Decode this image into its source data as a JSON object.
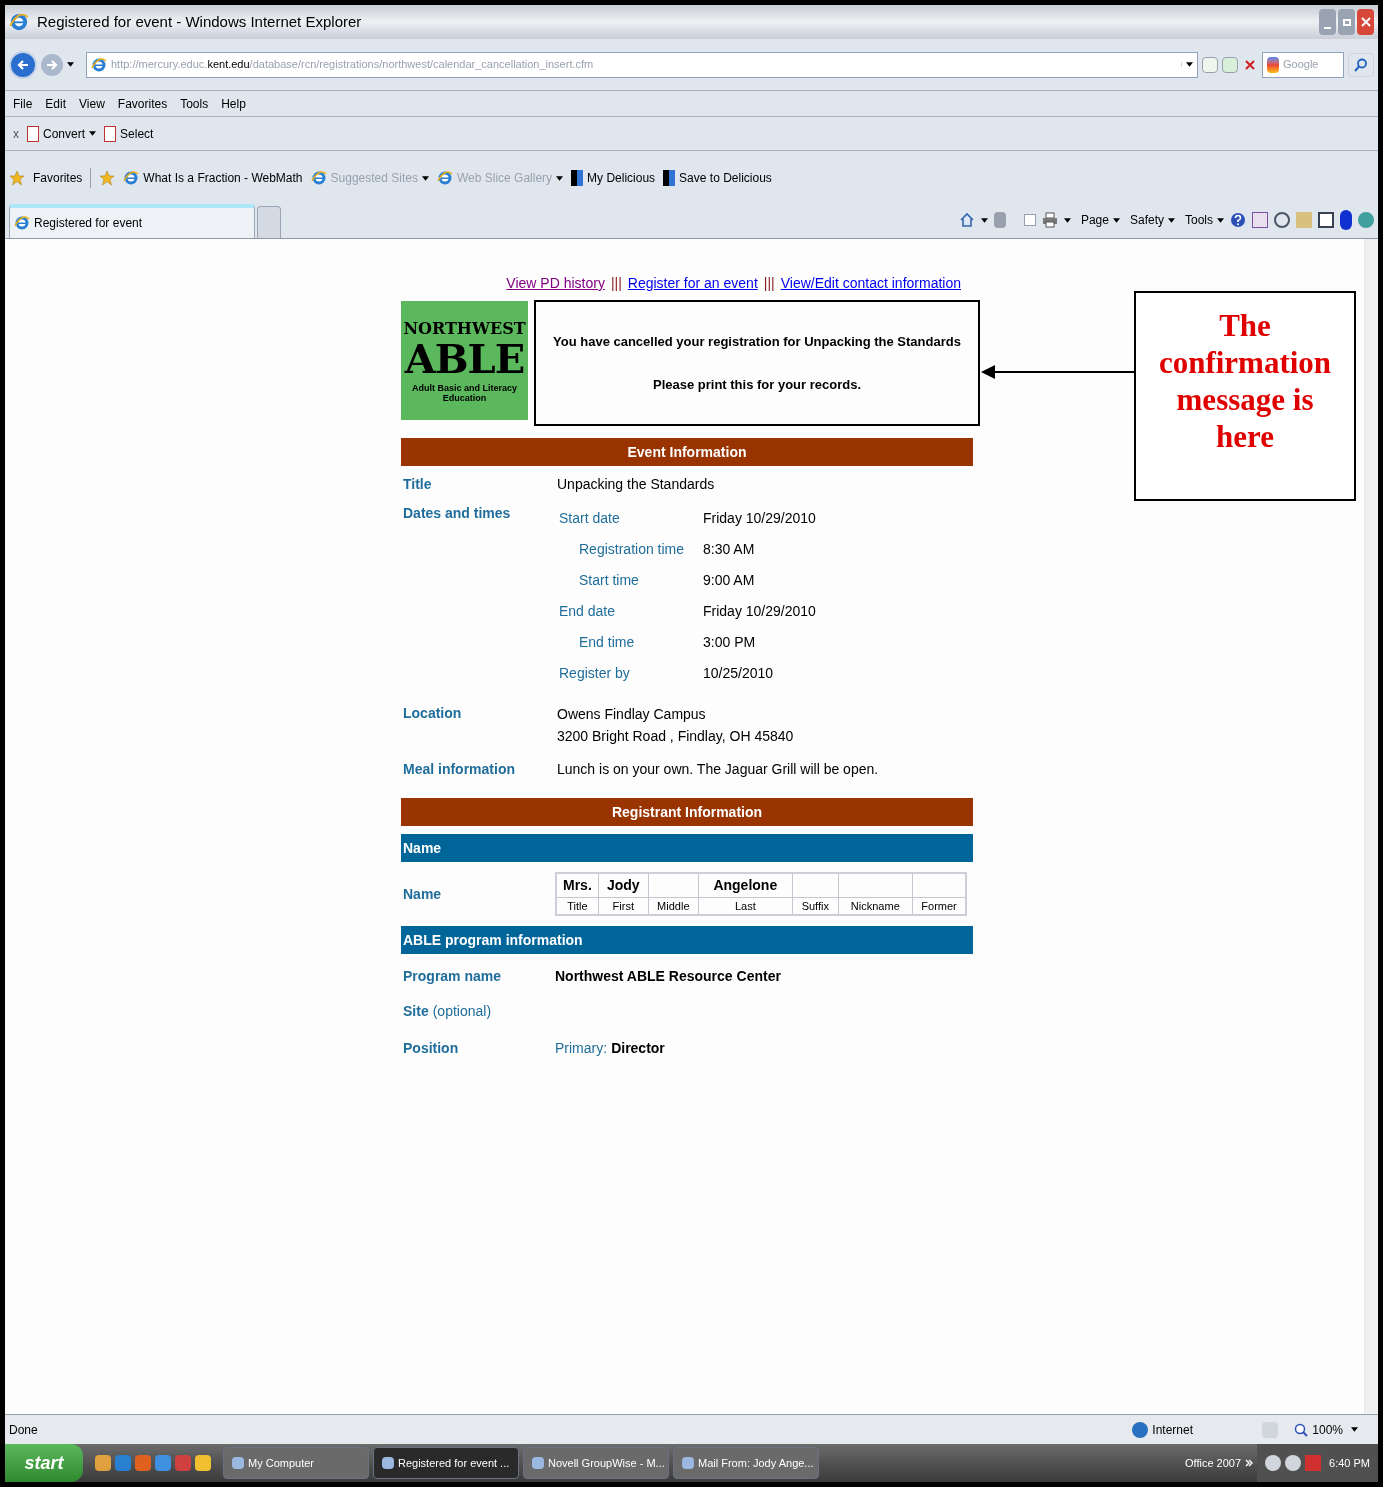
{
  "window": {
    "title": "Registered for event - Windows Internet Explorer"
  },
  "address": {
    "prefix": "http://mercury.educ.",
    "domain": "kent.edu",
    "path": "/database/rcn/registrations/northwest/calendar_cancellation_insert.cfm"
  },
  "search": {
    "placeholder": "Google"
  },
  "menu": [
    "File",
    "Edit",
    "View",
    "Favorites",
    "Tools",
    "Help"
  ],
  "addon_bar": {
    "close": "x",
    "items": [
      {
        "label": "Convert",
        "dropdown": true
      },
      {
        "label": "Select",
        "dropdown": false
      }
    ]
  },
  "favorites_bar": {
    "label": "Favorites",
    "items": [
      {
        "label": "What Is a Fraction - WebMath",
        "kind": "page",
        "dimmed": false,
        "dropdown": false
      },
      {
        "label": "Suggested Sites",
        "kind": "page",
        "dimmed": true,
        "dropdown": true
      },
      {
        "label": "Web Slice Gallery",
        "kind": "page",
        "dimmed": true,
        "dropdown": true
      },
      {
        "label": "My Delicious",
        "kind": "delicious",
        "dimmed": false,
        "dropdown": false
      },
      {
        "label": "Save to Delicious",
        "kind": "delicious",
        "dimmed": false,
        "dropdown": false
      }
    ]
  },
  "tabs": [
    {
      "label": "Registered for event",
      "selected": true
    }
  ],
  "command_menus": [
    "Page",
    "Safety",
    "Tools"
  ],
  "nav_links": [
    {
      "label": "View PD history",
      "visited": true
    },
    {
      "label": "Register for an event",
      "visited": false
    },
    {
      "label": "View/Edit contact information",
      "visited": false
    }
  ],
  "nav_separator": "|||",
  "logo": {
    "top": "NORTHWEST",
    "main": "ABLE",
    "tagline": "Adult Basic and Literacy Education"
  },
  "message": {
    "line1": "You have cancelled your registration for Unpacking the Standards",
    "line2": "Please print this for your records."
  },
  "callout": {
    "text": "The confirmation message is here"
  },
  "event_info": {
    "heading": "Event Information",
    "title": {
      "label": "Title",
      "value": "Unpacking the Standards"
    },
    "dates": {
      "label": "Dates and times",
      "items": [
        {
          "label": "Start date",
          "value": "Friday 10/29/2010",
          "children": [
            {
              "label": "Registration time",
              "value": "8:30 AM"
            },
            {
              "label": "Start time",
              "value": "9:00 AM"
            }
          ]
        },
        {
          "label": "End date",
          "value": "Friday 10/29/2010",
          "children": [
            {
              "label": "End time",
              "value": "3:00 PM"
            }
          ]
        },
        {
          "label": "Register by",
          "value": "10/25/2010"
        }
      ]
    },
    "location": {
      "label": "Location",
      "lines": [
        "Owens Findlay Campus",
        "3200 Bright Road , Findlay, OH 45840"
      ]
    },
    "meal": {
      "label": "Meal information",
      "value": "Lunch is on your own. The Jaguar Grill will be open."
    }
  },
  "registrant": {
    "heading": "Registrant Information",
    "name_section": "Name",
    "name_label": "Name",
    "name_columns": [
      {
        "value": "Mrs.",
        "caption": "Title"
      },
      {
        "value": "Jody",
        "caption": "First"
      },
      {
        "caption": "Middle"
      },
      {
        "value": "Angelone",
        "caption": "Last"
      },
      {
        "caption": "Suffix"
      },
      {
        "caption": "Nickname"
      },
      {
        "caption": "Former"
      }
    ],
    "program_section": "ABLE program information",
    "program_name": {
      "label": "Program name",
      "value": "Northwest ABLE Resource Center"
    },
    "site": {
      "label": "Site",
      "note": "(optional)"
    },
    "position": {
      "label": "Position",
      "qualifier": "Primary:",
      "value": "Director"
    }
  },
  "status_bar": {
    "text": "Done",
    "zone": "Internet",
    "zoom": "100%"
  },
  "taskbar": {
    "start": "start",
    "tasks": [
      {
        "label": "My Computer",
        "selected": false
      },
      {
        "label": "Registered for event ...",
        "selected": true
      },
      {
        "label": "Novell GroupWise - M...",
        "selected": false
      },
      {
        "label": "Mail From: Jody Ange...",
        "selected": false
      }
    ],
    "toolbar": "Office 2007",
    "time": "6:40 PM"
  }
}
